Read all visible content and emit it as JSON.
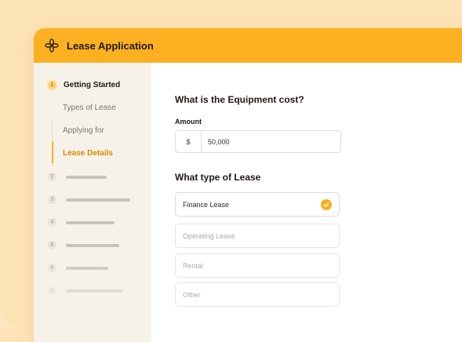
{
  "app": {
    "title": "Lease Application",
    "accent_color": "#fbb021",
    "logo_icon": "asterisk-flower-icon"
  },
  "sidebar": {
    "steps": [
      {
        "number": "1",
        "label": "Getting Started",
        "active": true,
        "substeps": [
          {
            "label": "Types of Lease"
          },
          {
            "label": "Applying for"
          },
          {
            "label": "Lease Details",
            "active": true
          }
        ]
      },
      {
        "number": "2"
      },
      {
        "number": "3"
      },
      {
        "number": "4"
      },
      {
        "number": "5"
      },
      {
        "number": "6"
      },
      {
        "number": "7"
      }
    ]
  },
  "form": {
    "cost_question": "What is the Equipment cost?",
    "amount_label": "Amount",
    "currency_symbol": "$",
    "amount_value": "50,000",
    "lease_type_question": "What type of Lease",
    "lease_options": [
      {
        "label": "Finance Lease",
        "selected": true,
        "icon": "check-icon"
      },
      {
        "label": "Operating Lease",
        "selected": false
      },
      {
        "label": "Rental",
        "selected": false
      },
      {
        "label": "Other",
        "selected": false
      }
    ]
  }
}
